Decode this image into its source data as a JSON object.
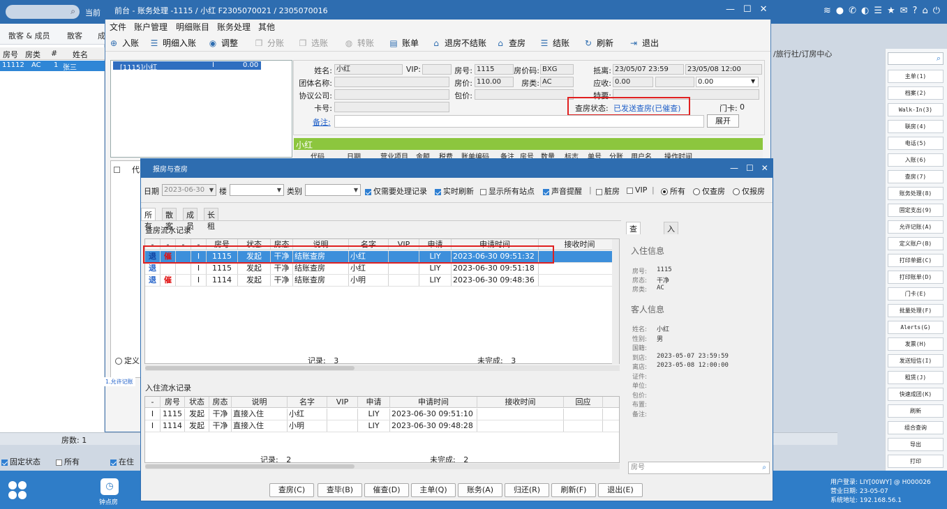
{
  "main_app": {
    "current_label": "当前",
    "tabs": [
      "散客 & 成员",
      "散客",
      "成"
    ],
    "columns": [
      "房号",
      "房类",
      "#",
      "姓名"
    ],
    "row": {
      "room": "11112",
      "type": "AC",
      "n": "1",
      "name": "张三"
    },
    "room_count": "房数: 1",
    "filters": [
      {
        "label": "固定状态",
        "checked": true
      },
      {
        "label": "所有",
        "checked": false
      },
      {
        "label": "在住",
        "checked": true
      }
    ],
    "right_col_header": "/旅行社/订房中心",
    "taskbar": {
      "clock_label": "钟点房",
      "user": "用户登录: LIY[00WY] @ H000026",
      "biz_date": "营业日期: 23-05-07",
      "sys_addr": "系统地址: 192.168.56.1"
    },
    "right_buttons": [
      "主单(1)",
      "档案(2)",
      "Walk-In(3)",
      "联房(4)",
      "电话(5)",
      "入账(6)",
      "查房(7)",
      "账务处理(8)",
      "固定支出(9)",
      "允许记账(A)",
      "定义账户(B)",
      "打印单据(C)",
      "打印账单(D)",
      "门卡(E)",
      "批量处理(F)",
      "Alerts(G)",
      "发票(H)",
      "发送短信(I)",
      "租赁(J)",
      "快速成团(K)",
      "刷新",
      "组合查询",
      "导出",
      "打印"
    ],
    "left_allow_tab": "1.允许记账"
  },
  "window": {
    "title": "前台 - 账务处理 -1115 / 小红 F2305070021 / 2305070016",
    "menu": [
      "文件",
      "账户管理",
      "明细账目",
      "账务处理",
      "其他"
    ],
    "toolbar": [
      {
        "label": "入账",
        "icon": "plus-icon",
        "enabled": true
      },
      {
        "label": "明细入账",
        "icon": "list-icon",
        "enabled": true
      },
      {
        "label": "调整",
        "icon": "adjust-icon",
        "enabled": true
      },
      {
        "label": "分账",
        "icon": "split-icon",
        "enabled": false
      },
      {
        "label": "选账",
        "icon": "select-icon",
        "enabled": false
      },
      {
        "label": "转账",
        "icon": "transfer-icon",
        "enabled": false
      },
      {
        "label": "账单",
        "icon": "bill-icon",
        "enabled": true
      },
      {
        "label": "退房不结账",
        "icon": "home-icon",
        "enabled": true
      },
      {
        "label": "查房",
        "icon": "house-check-icon",
        "enabled": true
      },
      {
        "label": "结账",
        "icon": "coins-icon",
        "enabled": true
      },
      {
        "label": "刷新",
        "icon": "refresh-icon",
        "enabled": true
      },
      {
        "label": "退出",
        "icon": "exit-icon",
        "enabled": true
      }
    ],
    "guest_entry": {
      "room": "[1115]小红",
      "status": "I",
      "amount": "0.00"
    },
    "info": {
      "name_label": "姓名:",
      "name": "小红",
      "vip_label": "VIP:",
      "vip": "",
      "room_label": "房号:",
      "room": "1115",
      "room_code_label": "房价码:",
      "room_code": "BXG",
      "arr_label": "抵离:",
      "arr": "23/05/07 23:59",
      "dep": "23/05/08 12:00",
      "group_label": "团体名称:",
      "group": "",
      "price_label": "房价:",
      "price": "110.00",
      "type_label": "房类:",
      "type": "AC",
      "due_label": "应收:",
      "due": "0.00",
      "due2": "",
      "due3": "0.00",
      "company_label": "协议公司:",
      "company": "",
      "pkg_label": "包价:",
      "pkg": "",
      "special_label": "特要:",
      "card_label": "卡号:",
      "card": "",
      "check_status_label": "查房状态:",
      "check_status": "已发送查房(已催查)",
      "door_label": "门卡:",
      "door": "0",
      "memo_label": "备注:",
      "memo": "",
      "expand_label": "展开"
    },
    "account_name": "小红",
    "account_columns": [
      "代码",
      "日期",
      "营业项目",
      "金额",
      "税费",
      "账单编码",
      "备注",
      "房号",
      "数量",
      "标志",
      "单号",
      "分账",
      "用户名",
      "操作时间"
    ],
    "left_lower_head": "代",
    "left_lower_radio": "定义"
  },
  "dialog": {
    "title": "报房与查房",
    "filter": {
      "date_label": "日期",
      "date": "2023-06-30",
      "floor_label": "楼",
      "floor": "",
      "category_label": "类别",
      "category": "",
      "opts": [
        {
          "label": "仅需要处理记录",
          "checked": true
        },
        {
          "label": "实时刷新",
          "checked": true
        },
        {
          "label": "显示所有站点",
          "checked": false
        },
        {
          "label": "声音提醒",
          "checked": true
        },
        {
          "label": "脏房",
          "checked": false
        },
        {
          "label": "VIP",
          "checked": false
        }
      ],
      "radios": [
        {
          "label": "所有",
          "on": true
        },
        {
          "label": "仅查房",
          "on": false
        },
        {
          "label": "仅报房",
          "on": false
        }
      ]
    },
    "tabs": [
      "所有",
      "散客",
      "成员",
      "长租"
    ],
    "check_section": "查房流水记录",
    "check_columns": [
      "-",
      "-",
      "-",
      "-",
      "房号",
      "状态",
      "房态",
      "说明",
      "名字",
      "VIP",
      "申请",
      "申请时间",
      "接收时间"
    ],
    "check_rows": [
      [
        "退",
        "催",
        "",
        "I",
        "1115",
        "发起",
        "干净",
        "结账查房",
        "小红",
        "",
        "LIY",
        "2023-06-30 09:51:32",
        ""
      ],
      [
        "退",
        "",
        "",
        "I",
        "1115",
        "发起",
        "干净",
        "结账查房",
        "小红",
        "",
        "LIY",
        "2023-06-30 09:51:18",
        ""
      ],
      [
        "退",
        "催",
        "",
        "I",
        "1114",
        "发起",
        "干净",
        "结账查房",
        "小明",
        "",
        "LIY",
        "2023-06-30 09:48:36",
        ""
      ]
    ],
    "check_footer": {
      "records_label": "记录:",
      "records": "3",
      "incomplete_label": "未完成:",
      "incomplete": "3"
    },
    "checkin_section": "入住流水记录",
    "checkin_columns": [
      "-",
      "房号",
      "状态",
      "房态",
      "说明",
      "名字",
      "VIP",
      "申请",
      "申请时间",
      "接收时间",
      "回应"
    ],
    "checkin_rows": [
      [
        "I",
        "1115",
        "发起",
        "干净",
        "直接入住",
        "小红",
        "",
        "LIY",
        "2023-06-30 09:51:10",
        "",
        ""
      ],
      [
        "I",
        "1114",
        "发起",
        "干净",
        "直接入住",
        "小明",
        "",
        "LIY",
        "2023-06-30 09:48:28",
        "",
        ""
      ]
    ],
    "checkin_footer": {
      "records_label": "记录:",
      "records": "2",
      "incomplete_label": "未完成:",
      "incomplete": "2"
    },
    "detail_tabs": [
      "查房流水",
      "入住流水"
    ],
    "checkin_info_title": "入住信息",
    "checkin_info": [
      {
        "k": "房号:",
        "v": "1115"
      },
      {
        "k": "房态:",
        "v": "干净"
      },
      {
        "k": "房类:",
        "v": "AC"
      }
    ],
    "guest_info_title": "客人信息",
    "guest_info": [
      {
        "k": "姓名:",
        "v": "小红"
      },
      {
        "k": "性别:",
        "v": "男"
      },
      {
        "k": "国籍:",
        "v": ""
      },
      {
        "k": "到店:",
        "v": "2023-05-07 23:59:59"
      },
      {
        "k": "离店:",
        "v": "2023-05-08 12:00:00"
      },
      {
        "k": "证件:",
        "v": ""
      },
      {
        "k": "单位:",
        "v": ""
      },
      {
        "k": "包价:",
        "v": ""
      },
      {
        "k": "布置:",
        "v": ""
      },
      {
        "k": "备注:",
        "v": ""
      }
    ],
    "search_placeholder": "房号",
    "buttons": [
      "查房(C)",
      "查毕(B)",
      "催查(D)",
      "主单(Q)",
      "账务(A)",
      "归还(R)",
      "刷新(F)",
      "退出(E)"
    ]
  }
}
